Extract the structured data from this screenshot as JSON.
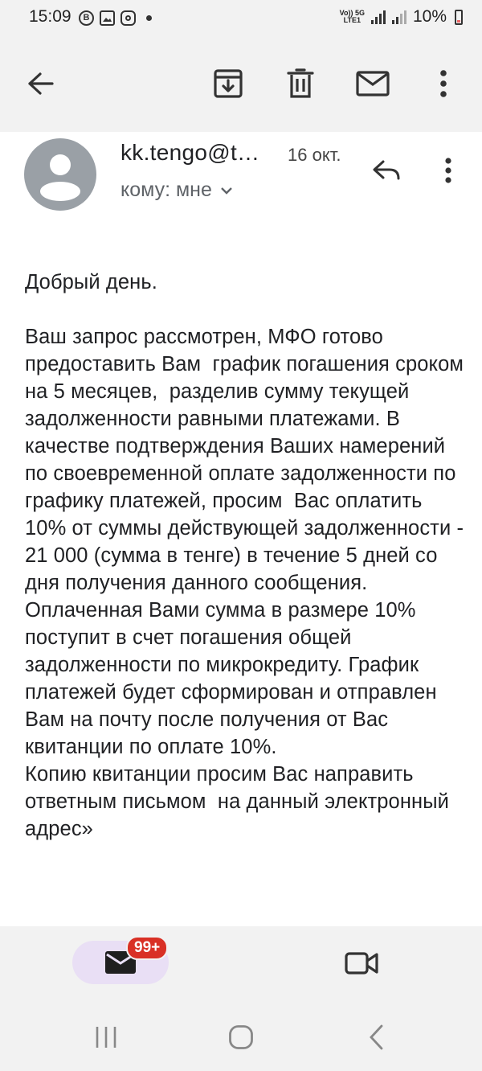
{
  "status_bar": {
    "time": "15:09",
    "network_label_top": "Vo)) 5G",
    "network_label_bottom": "LTE1",
    "battery": "10%",
    "battery_color": "#e66"
  },
  "toolbar": {
    "back_icon": "arrow-left-icon",
    "archive_icon": "archive-icon",
    "delete_icon": "trash-icon",
    "mark_unread_icon": "envelope-icon",
    "more_icon": "more-vert-icon"
  },
  "email": {
    "sender": "kk.tengo@t…",
    "date": "16 окт.",
    "recipient": "кому: мне",
    "body": "Добрый день.\n\nВаш запрос рассмотрен, МФО готово предоставить Вам  график погашения сроком на 5 месяцев,  разделив сумму текущей задолженности равными платежами. В качестве подтверждения Ваших намерений по своевременной оплате задолженности по графику платежей, просим  Вас оплатить 10% от суммы действующей задолженности - 21 000 (сумма в тенге) в течение 5 дней со дня получения данного сообщения. Оплаченная Вами сумма в размере 10% поступит в счет погашения общей задолженности по микрокредиту. График платежей будет сформирован и отправлен Вам на почту после получения от Вас квитанции по оплате 10%.\nКопию квитанции просим Вас направить ответным письмом  на данный электронный адрес»"
  },
  "bottom_nav": {
    "mail_badge": "99+",
    "pill_color": "#e9dff5",
    "badge_color": "#d93025"
  }
}
